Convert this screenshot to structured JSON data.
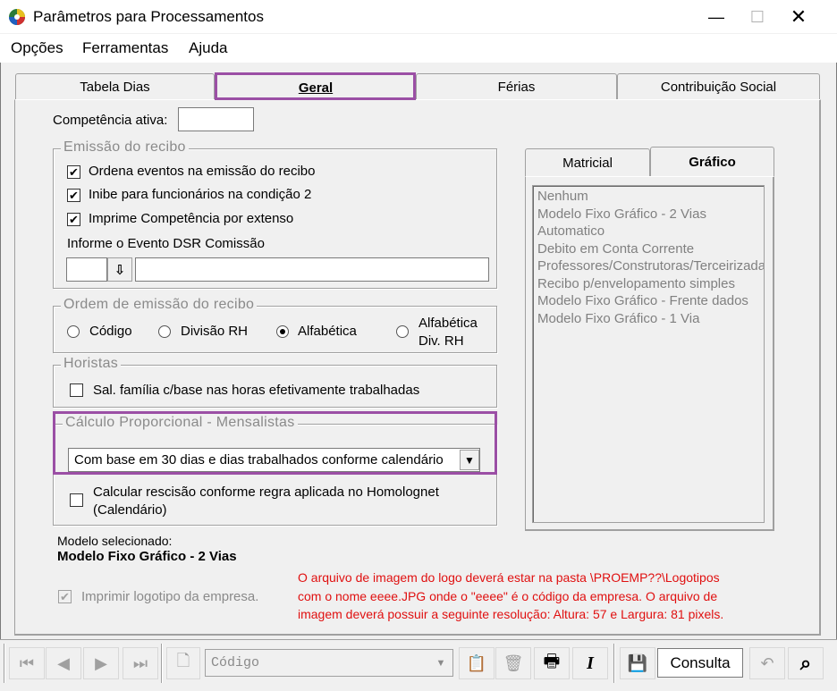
{
  "window": {
    "title": "Parâmetros para Processamentos",
    "minimize": "—",
    "maximize": "☐",
    "close": "✕"
  },
  "menu": [
    {
      "label": "Opções"
    },
    {
      "label": "Ferramentas"
    },
    {
      "label": "Ajuda"
    }
  ],
  "tabs": [
    {
      "label": "Tabela Dias"
    },
    {
      "label": "Geral"
    },
    {
      "label": "Férias"
    },
    {
      "label": "Contribuição Social"
    }
  ],
  "active_tab": "Geral",
  "competencia": {
    "label": "Competência ativa:",
    "value": ""
  },
  "emissao": {
    "title": "Emissão do recibo",
    "checks": [
      {
        "label": "Ordena eventos na emissão do recibo",
        "checked": "✔"
      },
      {
        "label": "Inibe para funcionários na condição 2",
        "checked": "✔"
      },
      {
        "label": "Imprime Competência por extenso",
        "checked": "✔"
      }
    ],
    "dsr_label": "Informe o Evento DSR Comissão",
    "dsr_code": "",
    "dsr_desc": "",
    "dsr_btn": "⇩"
  },
  "ordem": {
    "title": "Ordem de emissão do recibo",
    "options": [
      "Código",
      "Divisão RH",
      "Alfabética"
    ],
    "option4_line1": "Alfabética",
    "option4_line2": "Div. RH",
    "selected": "Alfabética"
  },
  "horistas": {
    "title": "Horistas",
    "check_label": "Sal. família c/base nas horas efetivamente trabalhadas"
  },
  "calculo": {
    "title": "Cálculo Proporcional - Mensalistas",
    "combo_value": "Com base em 30 dias e dias trabalhados conforme calendário",
    "combo_btn": "▼"
  },
  "rescisao": {
    "line1": "Calcular rescisão conforme regra aplicada no Homolognet",
    "line2": "(Calendário)"
  },
  "right_tabs": [
    {
      "label": "Matricial"
    },
    {
      "label": "Gráfico"
    }
  ],
  "right_active": "Gráfico",
  "models": [
    "Nenhum",
    "Modelo Fixo Gráfico - 2 Vias",
    "Automatico",
    "Debito em Conta Corrente",
    "Professores/Construtoras/Terceirizadas",
    "Recibo p/envelopamento simples",
    "Modelo Fixo Gráfico - Frente dados",
    "Modelo Fixo Gráfico - 1 Via"
  ],
  "modelo": {
    "label": "Modelo selecionado:",
    "value": "Modelo Fixo Gráfico - 2 Vias"
  },
  "logotipo": {
    "label": "Imprimir logotipo da empresa.",
    "checked": "✔"
  },
  "note": {
    "line1": "O arquivo de imagem do logo deverá estar na pasta \\PROEMP??\\Logotipos",
    "line2": "com o nome eeee.JPG onde o \"eeee\" é o código da empresa. O arquivo de",
    "line3": "imagem deverá possuir a seguinte resolução: Altura: 57 e Largura: 81 pixels."
  },
  "toolbar": {
    "first": "⏮",
    "prev": "◀",
    "next": "▶",
    "last": "⏭",
    "new": "🗋",
    "search_value": "Código",
    "search_btn": "▼",
    "doc_icon": "📋",
    "trash": "🗑",
    "print": "🖶",
    "italic": "I",
    "save": "💾",
    "mode": "Consulta",
    "undo": "↶",
    "binoculars": "⌕"
  },
  "colors": {
    "highlight": "#9b4fa5",
    "note_red": "#e01010",
    "disabled_text": "#808080"
  }
}
